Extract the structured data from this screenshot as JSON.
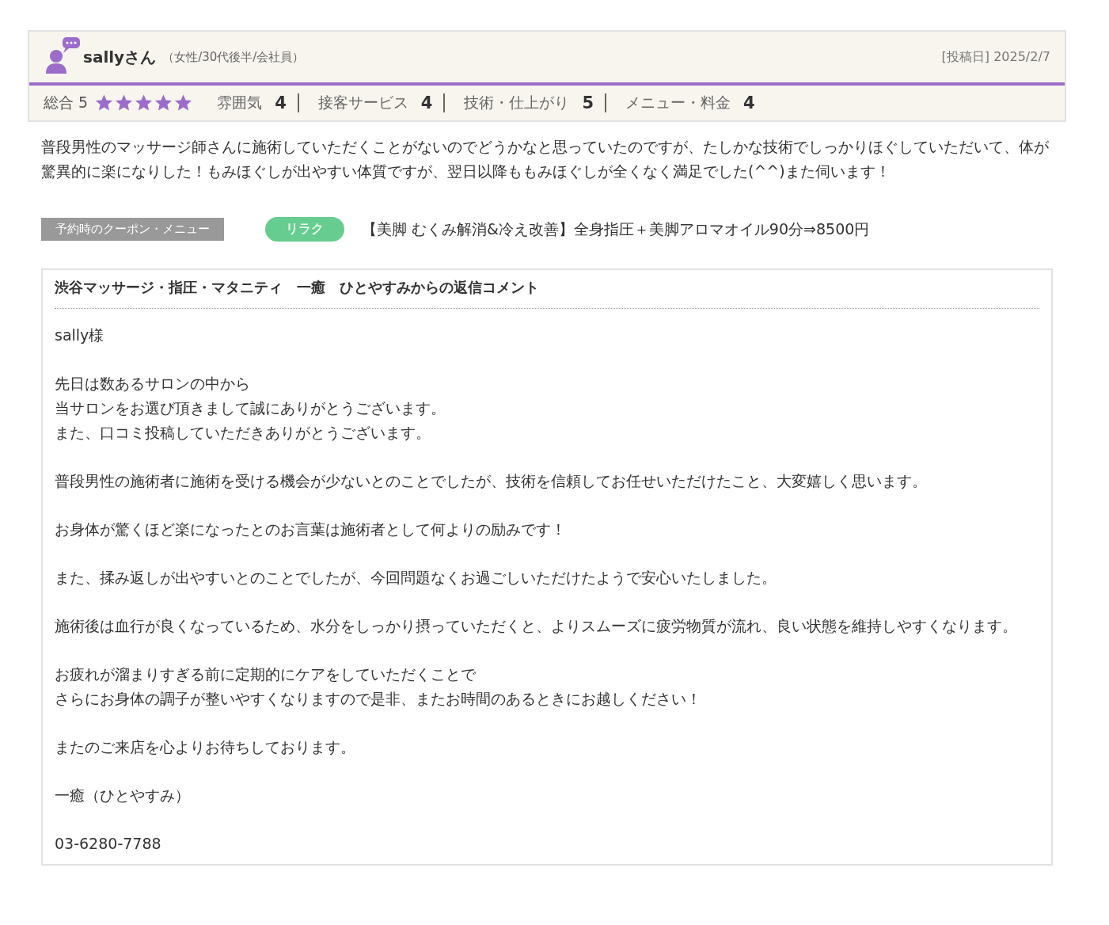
{
  "review": {
    "reviewer": "sallyさん",
    "profile": "（女性/30代後半/会社員）",
    "posted_date": "[投稿日] 2025/2/7",
    "overall": {
      "label": "総合",
      "value": "5",
      "stars": 5
    },
    "ratings": [
      {
        "label": "雰囲気",
        "value": "4"
      },
      {
        "label": "接客サービス",
        "value": "4"
      },
      {
        "label": "技術・仕上がり",
        "value": "5"
      },
      {
        "label": "メニュー・料金",
        "value": "4"
      }
    ],
    "body": "普段男性のマッサージ師さんに施術していただくことがないのでどうかなと思っていたのですが、たしかな技術でしっかりほぐしていただいて、体が驚異的に楽になりした！もみほぐしが出やすい体質ですが、翌日以降ももみほぐしが全くなく満足でした(^^)また伺います！",
    "coupon": {
      "label": "予約時のクーポン・メニュー",
      "tag": "リラク",
      "text": "【美脚 むくみ解消&冷え改善】全身指圧＋美脚アロマオイル90分⇒8500円"
    }
  },
  "reply": {
    "title": "渋谷マッサージ・指圧・マタニティ　一癒　ひとやすみからの返信コメント",
    "paragraphs": [
      [
        "sally様"
      ],
      [
        "先日は数あるサロンの中から",
        "当サロンをお選び頂きまして誠にありがとうございます。",
        "また、口コミ投稿していただきありがとうございます。"
      ],
      [
        "普段男性の施術者に施術を受ける機会が少ないとのことでしたが、技術を信頼してお任せいただけたこと、大変嬉しく思います。"
      ],
      [
        "お身体が驚くほど楽になったとのお言葉は施術者として何よりの励みです！"
      ],
      [
        "また、揉み返しが出やすいとのことでしたが、今回問題なくお過ごしいただけたようで安心いたしました。"
      ],
      [
        "施術後は血行が良くなっているため、水分をしっかり摂っていただくと、よりスムーズに疲労物質が流れ、良い状態を維持しやすくなります。"
      ],
      [
        "お疲れが溜まりすぎる前に定期的にケアをしていただくことで",
        "さらにお身体の調子が整いやすくなりますので是非、またお時間のあるときにお越しください！"
      ],
      [
        "またのご来店を心よりお待ちしております。"
      ],
      [
        "一癒（ひとやすみ）"
      ],
      [
        "03-6280-7788"
      ]
    ]
  }
}
